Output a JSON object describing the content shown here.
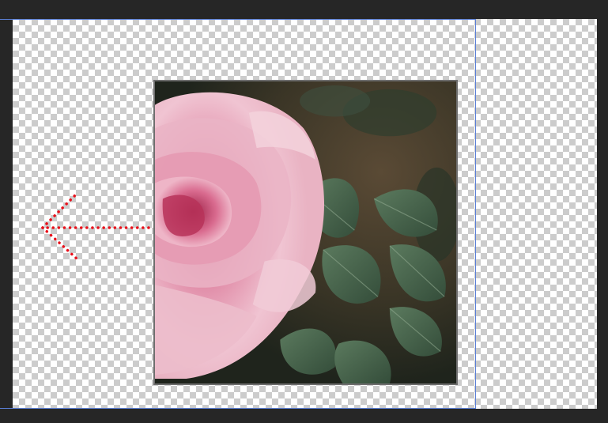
{
  "canvas": {
    "background": "transparency-checkerboard",
    "guide_color": "#5a7fd6"
  },
  "layer": {
    "content": "rose-photo",
    "border_color": "#6e6e6e"
  },
  "annotation": {
    "icon": "dotted-left-arrow-icon",
    "color": "#e8111b",
    "direction": "left"
  }
}
